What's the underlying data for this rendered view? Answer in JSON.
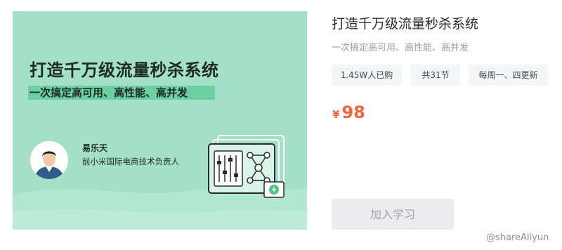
{
  "cover": {
    "title": "打造千万级流量秒杀系统",
    "subtitle": "一次搞定高可用、高性能、高并发",
    "lecturer_name": "易乐天",
    "lecturer_title": "前小米国际电商技术负责人",
    "background_color": "#a4e0c8",
    "highlight_color": "#6ccfa2"
  },
  "course": {
    "title": "打造千万级流量秒杀系统",
    "subtitle": "一次搞定高可用、高性能、高并发",
    "tags": [
      "1.45W人已购",
      "共31节",
      "每周一、四更新"
    ],
    "price_symbol": "¥",
    "price": "98",
    "price_color": "#f0653a",
    "join_label": "加入学习"
  },
  "watermark": "@shareAliyun",
  "icons": {
    "avatar": "lecturer-avatar-photo",
    "illustration": "server-equalizer-network-illustration",
    "badge": "refresh-lightning-icon"
  }
}
